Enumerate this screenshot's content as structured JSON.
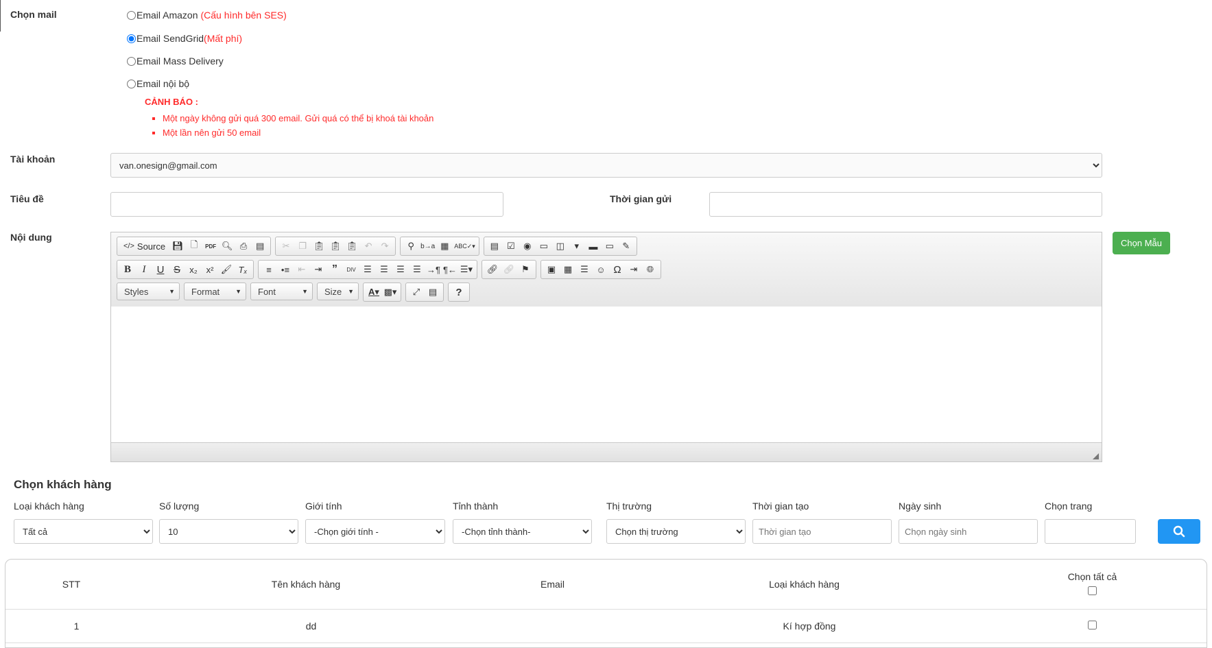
{
  "mail": {
    "label": "Chọn mail",
    "options": [
      {
        "text": "Email Amazon",
        "note": "(Cấu hình bên SES)",
        "checked": false
      },
      {
        "text": "Email SendGrid",
        "note": "(Mất phí)",
        "checked": true
      },
      {
        "text": "Email Mass Delivery",
        "note": "",
        "checked": false
      },
      {
        "text": "Email nội bộ",
        "note": "",
        "checked": false
      }
    ],
    "warning_title": "CẢNH BÁO :",
    "warnings": [
      "Một ngày không gửi quá 300 email. Gửi quá có thể bị khoá tài khoản",
      "Một lần nên gửi 50 email"
    ]
  },
  "account": {
    "label": "Tài khoản",
    "value": "van.onesign@gmail.com"
  },
  "subject": {
    "label": "Tiêu đề",
    "value": ""
  },
  "send_time": {
    "label": "Thời gian gửi",
    "value": ""
  },
  "content": {
    "label": "Nội dung",
    "template_button": "Chọn Mẫu"
  },
  "editor": {
    "source_label": "Source",
    "styles_label": "Styles",
    "format_label": "Format",
    "font_label": "Font",
    "size_label": "Size"
  },
  "customers": {
    "title": "Chọn khách hàng",
    "filters": {
      "type_label": "Loại khách hàng",
      "type_value": "Tất cả",
      "qty_label": "Số lượng",
      "qty_value": "10",
      "gender_label": "Giới tính",
      "gender_value": "-Chọn giới tính -",
      "province_label": "Tỉnh thành",
      "province_value": "-Chọn tỉnh thành-",
      "market_label": "Thị trường",
      "market_value": "Chọn thị trường",
      "created_label": "Thời gian tạo",
      "created_placeholder": "Thời gian tạo",
      "birthday_label": "Ngày sinh",
      "birthday_placeholder": "Chọn ngày sinh",
      "page_label": "Chọn trang",
      "page_value": ""
    },
    "table": {
      "headers": [
        "STT",
        "Tên khách hàng",
        "Email",
        "Loại khách hàng",
        "Chọn tất cả"
      ],
      "rows": [
        {
          "stt": "1",
          "name": "dd",
          "email": "",
          "type": "Kí hợp đồng"
        }
      ]
    }
  }
}
